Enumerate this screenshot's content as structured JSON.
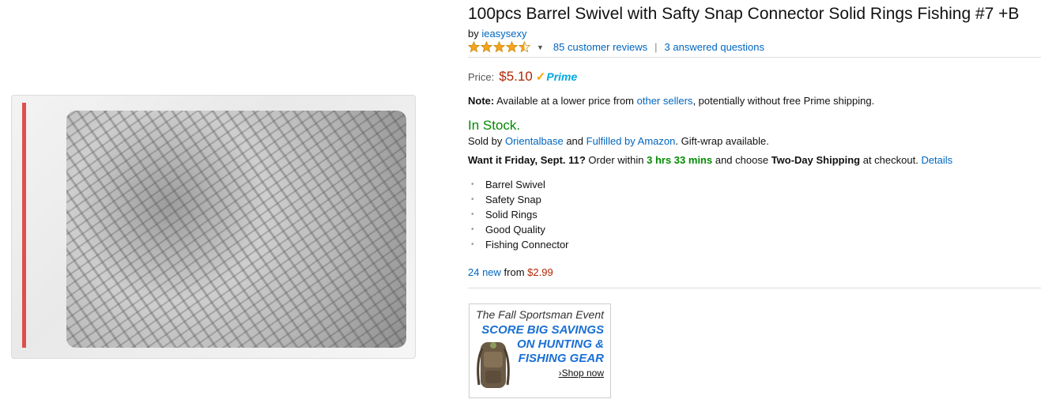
{
  "product": {
    "title": "100pcs Barrel Swivel with Safty Snap Connector Solid Rings Fishing #7 +B",
    "by_prefix": "by",
    "brand": "ieasysexy",
    "rating": 4.5,
    "reviews": "85 customer reviews",
    "separator": "|",
    "questions": "3 answered questions"
  },
  "price": {
    "label": "Price:",
    "value": "$5.10",
    "prime_check": "✓",
    "prime_label": "Prime"
  },
  "note": {
    "label": "Note:",
    "text1": " Available at a lower price from ",
    "link": "other sellers",
    "text2": ", potentially without free Prime shipping."
  },
  "availability": {
    "stock": "In Stock.",
    "sold_prefix": "Sold by ",
    "seller": "Orientalbase",
    "and": " and ",
    "fulfilled": "Fulfilled by Amazon",
    "gift": ". Gift-wrap available."
  },
  "delivery": {
    "want": "Want it Friday, Sept. 11?",
    "order_within": " Order within ",
    "countdown": "3 hrs 33 mins",
    "choose": " and choose ",
    "shipping": "Two-Day Shipping",
    "checkout": " at checkout. ",
    "details": "Details"
  },
  "features": [
    "Barrel Swivel",
    "Safety Snap",
    "Solid Rings",
    "Good Quality",
    "Fishing Connector"
  ],
  "offers": {
    "count_link": "24 new",
    "from": " from ",
    "price": "$2.99"
  },
  "ad": {
    "top": "The Fall Sportsman Event",
    "line1": "SCORE BIG SAVINGS",
    "line2": "ON HUNTING &",
    "line3": "FISHING GEAR",
    "shop": "Shop now",
    "shop_arrow": "›"
  },
  "colors": {
    "link": "#0066c0",
    "price": "#b12704",
    "stock": "#008a00",
    "star": "#f4a41d",
    "prime": "#00a8e1",
    "ad_blue": "#1a6fd4"
  },
  "icons": {
    "stars": "star-icon",
    "caret": "caret-down-icon",
    "prime": "prime-check-icon",
    "bullet": "bullet-icon"
  }
}
